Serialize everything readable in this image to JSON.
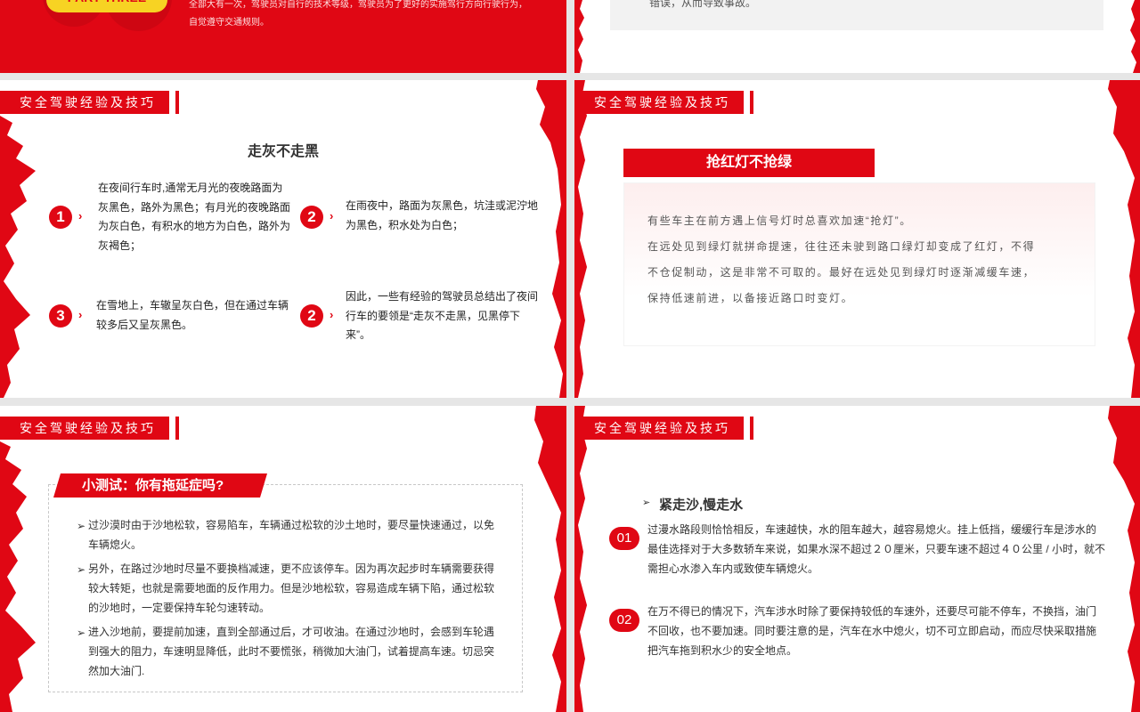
{
  "slide_a": {
    "pill": "PART THREE",
    "text": "全部大有一次，驾驶员对自行的技术等级，驾驶员为了更好的实施驾行方向行驶行为，自觉遵守交通规则。"
  },
  "slide_b": {
    "text": "错误，从而导致事故。"
  },
  "section_header": "安全驾驶经验及技巧",
  "slide_c": {
    "title": "走灰不走黑",
    "items": [
      {
        "num": "1",
        "text": "在夜间行车时,通常无月光的夜晚路面为灰黑色，路外为黑色；有月光的夜晚路面为灰白色，有积水的地方为白色，路外为灰褐色；"
      },
      {
        "num": "2",
        "text": "在雨夜中，路面为灰黑色，坑洼或泥泞地为黑色，积水处为白色；"
      },
      {
        "num": "3",
        "text": "在雪地上，车辙呈灰白色，但在通过车辆较多后又呈灰黑色。"
      },
      {
        "num": "2",
        "text": "因此，一些有经验的驾驶员总结出了夜间行车的要领是“走灰不走黑，见黑停下来”。"
      }
    ]
  },
  "slide_d": {
    "banner": "抢红灯不抢绿",
    "lines": [
      "有些车主在前方遇上信号灯时总喜欢加速“抢灯”。",
      "在远处见到绿灯就拼命提速，往往还未驶到路口绿灯却变成了红灯，不得",
      "不仓促制动，这是非常不可取的。最好在远处见到绿灯时逐渐减缓车速，",
      "保持低速前进，以备接近路口时变灯。"
    ]
  },
  "slide_e": {
    "banner": "小测试：你有拖延症吗?",
    "bullets": [
      "过沙漠时由于沙地松软，容易陷车，车辆通过松软的沙土地时，要尽量快速通过，以免车辆熄火。",
      "另外，在路过沙地时尽量不要换档减速，更不应该停车。因为再次起步时车辆需要获得较大转矩，也就是需要地面的反作用力。但是沙地松软，容易造成车辆下陷，通过松软的沙地时，一定要保持车轮匀速转动。",
      "进入沙地前，要提前加速，直到全部通过后，才可收油。在通过沙地时，会感到车轮遇到强大的阻力，车速明显降低，此时不要慌张，稍微加大油门，试着提高车速。切忌突然加大油门."
    ]
  },
  "slide_f": {
    "title": "紧走沙,慢走水",
    "items": [
      {
        "num": "01",
        "text": "过漫水路段则恰恰相反，车速越快，水的阻车越大，越容易熄火。挂上低挡，缓缓行车是涉水的最佳选择对于大多数轿车来说，如果水深不超过２０厘米，只要车速不超过４０公里 / 小时，就不需担心水渗入车内或致使车辆熄火。"
      },
      {
        "num": "02",
        "text": "在万不得已的情况下，汽车涉水时除了要保持较低的车速外，还要尽可能不停车，不换挡，油门不回收，也不要加速。同时要注意的是，汽车在水中熄火，切不可立即启动，而应尽快采取措施把汽车拖到积水少的安全地点。"
      }
    ]
  },
  "colors": {
    "accent": "#e00714",
    "yellow": "#f7d323"
  }
}
